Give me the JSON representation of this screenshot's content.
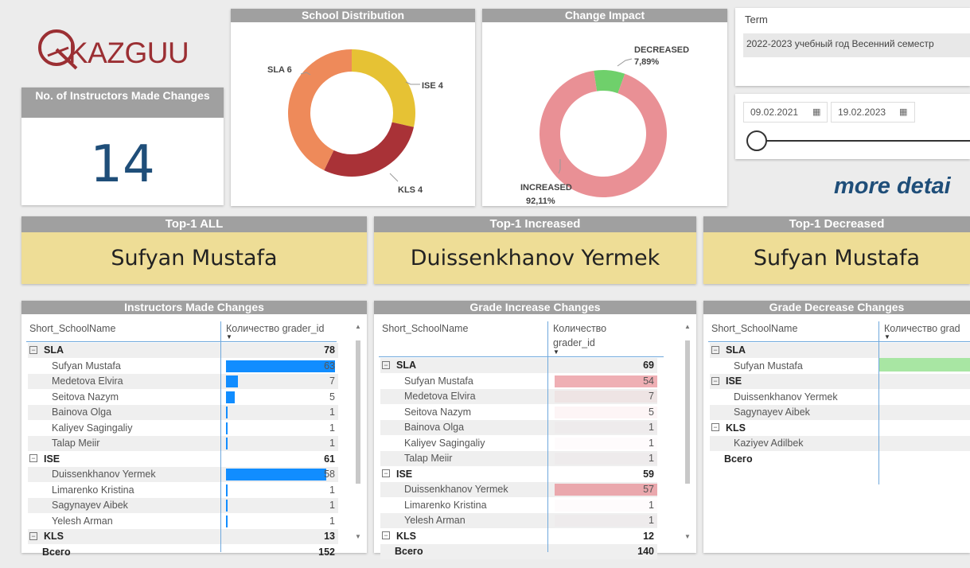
{
  "logo": {
    "letter_icon": "q-logo-icon",
    "text": "KAZGUU"
  },
  "kpi": {
    "title": "No. of Instructors Made Changes",
    "value": "14"
  },
  "school_dist": {
    "title": "School Distribution",
    "labels": {
      "sla": "SLA 6",
      "ise": "ISE 4",
      "kls": "KLS 4"
    },
    "colors": {
      "sla": "#ee8a5a",
      "ise": "#e6c234",
      "kls": "#a93237"
    }
  },
  "change_impact": {
    "title": "Change Impact",
    "dec_label": "DECREASED",
    "dec_pct": "7,89%",
    "inc_label": "INCREASED",
    "inc_pct": "92,11%",
    "colors": {
      "inc": "#e99095",
      "dec": "#6fd06b"
    }
  },
  "chart_data": [
    {
      "type": "pie",
      "title": "School Distribution",
      "categories": [
        "SLA",
        "ISE",
        "KLS"
      ],
      "values": [
        6,
        4,
        4
      ]
    },
    {
      "type": "pie",
      "title": "Change Impact",
      "categories": [
        "INCREASED",
        "DECREASED"
      ],
      "values": [
        92.11,
        7.89
      ]
    }
  ],
  "filters": {
    "term_label": "Term",
    "term_value": "2022-2023 учебный год Весенний семестр",
    "date_from": "09.02.2021",
    "date_to": "19.02.2023",
    "more_details": "more detai"
  },
  "top": {
    "all_title": "Top-1 ALL",
    "all_name": "Sufyan Mustafa",
    "inc_title": "Top-1 Increased",
    "inc_name": "Duissenkhanov Yermek",
    "dec_title": "Top-1 Decreased",
    "dec_name": "Sufyan Mustafa"
  },
  "table1": {
    "title": "Instructors Made Changes",
    "col1": "Short_SchoolName",
    "col2": "Количество grader_id",
    "rows": [
      {
        "name": "SLA",
        "value": "78"
      },
      {
        "name": "Sufyan Mustafa",
        "value": "63",
        "bar": 63
      },
      {
        "name": "Medetova Elvira",
        "value": "7",
        "bar": 7
      },
      {
        "name": "Seitova Nazym",
        "value": "5",
        "bar": 5
      },
      {
        "name": "Bainova Olga",
        "value": "1",
        "bar": 1
      },
      {
        "name": "Kaliyev Sagingaliy",
        "value": "1",
        "bar": 1
      },
      {
        "name": "Talap Meiir",
        "value": "1",
        "bar": 1
      },
      {
        "name": "ISE",
        "value": "61"
      },
      {
        "name": "Duissenkhanov Yermek",
        "value": "58",
        "bar": 58
      },
      {
        "name": "Limarenko Kristina",
        "value": "1",
        "bar": 1
      },
      {
        "name": "Sagynayev Aibek",
        "value": "1",
        "bar": 1
      },
      {
        "name": "Yelesh Arman",
        "value": "1",
        "bar": 1
      },
      {
        "name": "KLS",
        "value": "13"
      },
      {
        "name": "Всего",
        "value": "152"
      }
    ]
  },
  "table2": {
    "title": "Grade Increase Changes",
    "col1": "Short_SchoolName",
    "col2a": "Количество",
    "col2b": "grader_id",
    "rows": [
      {
        "name": "SLA",
        "value": "69"
      },
      {
        "name": "Sufyan Mustafa",
        "value": "54",
        "bar": 54
      },
      {
        "name": "Medetova Elvira",
        "value": "7",
        "bar": 7
      },
      {
        "name": "Seitova Nazym",
        "value": "5",
        "bar": 5
      },
      {
        "name": "Bainova Olga",
        "value": "1",
        "bar": 1
      },
      {
        "name": "Kaliyev Sagingaliy",
        "value": "1",
        "bar": 1
      },
      {
        "name": "Talap Meiir",
        "value": "1",
        "bar": 1
      },
      {
        "name": "ISE",
        "value": "59"
      },
      {
        "name": "Duissenkhanov Yermek",
        "value": "57",
        "bar": 57
      },
      {
        "name": "Limarenko Kristina",
        "value": "1",
        "bar": 1
      },
      {
        "name": "Yelesh Arman",
        "value": "1",
        "bar": 1
      },
      {
        "name": "KLS",
        "value": "12"
      },
      {
        "name": "Всего",
        "value": "140"
      }
    ]
  },
  "table3": {
    "title": "Grade Decrease Changes",
    "col1": "Short_SchoolName",
    "col2": "Количество grad",
    "rows": [
      {
        "name": "SLA"
      },
      {
        "name": "Sufyan Mustafa"
      },
      {
        "name": "ISE"
      },
      {
        "name": "Duissenkhanov Yermek"
      },
      {
        "name": "Sagynayev Aibek"
      },
      {
        "name": "KLS"
      },
      {
        "name": "Kaziyev Adilbek"
      },
      {
        "name": "Всего"
      }
    ]
  }
}
